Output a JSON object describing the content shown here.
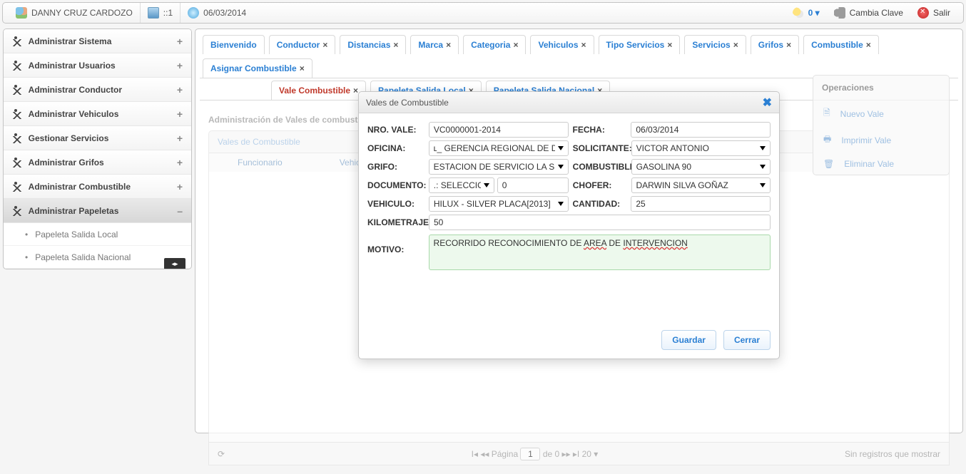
{
  "topbar": {
    "user": "DANNY CRUZ CARDOZO",
    "host": "::1",
    "date": "06/03/2014",
    "weather": "0 ▾",
    "changepw": "Cambia Clave",
    "exit": "Salir"
  },
  "sidebar": {
    "items": [
      {
        "label": "Administrar Sistema"
      },
      {
        "label": "Administrar Usuarios"
      },
      {
        "label": "Administrar Conductor"
      },
      {
        "label": "Administrar Vehiculos"
      },
      {
        "label": "Gestionar Servicios"
      },
      {
        "label": "Administrar Grifos"
      },
      {
        "label": "Administrar Combustible"
      },
      {
        "label": "Administrar Papeletas"
      }
    ],
    "subitems": [
      {
        "label": "Papeleta Salida Local"
      },
      {
        "label": "Papeleta Salida Nacional"
      }
    ]
  },
  "tabs": {
    "row1": [
      {
        "label": "Bienvenido",
        "closable": false
      },
      {
        "label": "Conductor",
        "closable": true
      },
      {
        "label": "Distancias",
        "closable": true
      },
      {
        "label": "Marca",
        "closable": true
      },
      {
        "label": "Categoria",
        "closable": true
      },
      {
        "label": "Vehiculos",
        "closable": true
      },
      {
        "label": "Tipo Servicios",
        "closable": true
      },
      {
        "label": "Servicios",
        "closable": true
      },
      {
        "label": "Grifos",
        "closable": true
      },
      {
        "label": "Combustible",
        "closable": true
      },
      {
        "label": "Asignar Combustible",
        "closable": true
      }
    ],
    "row2": [
      {
        "label": "Vale Combustible",
        "closable": true,
        "active": true
      },
      {
        "label": "Papeleta Salida Local",
        "closable": true
      },
      {
        "label": "Papeleta Salida Nacional",
        "closable": true
      }
    ]
  },
  "content": {
    "section_title": "Administración de Vales de combustible",
    "grid_title": "Vales de Combustible",
    "grid_cols": [
      "Funcionario",
      "Vehiculo"
    ],
    "pager": "Página",
    "pager_page": "1",
    "pager_of": "de 0",
    "pager_size": "20 ▾",
    "empty": "Sin registros que mostrar"
  },
  "ops": {
    "title": "Operaciones",
    "items": [
      "Nuevo Vale",
      "Imprimir Vale",
      "Eliminar Vale"
    ]
  },
  "modal": {
    "title": "Vales de Combustible",
    "labels": {
      "nro": "NRO. VALE:",
      "fecha": "FECHA:",
      "oficina": "OFICINA:",
      "solicitante": "SOLICITANTE:",
      "grifo": "GRIFO:",
      "combustible": "COMBUSTIBLE:",
      "documento": "DOCUMENTO:",
      "chofer": "CHOFER:",
      "vehiculo": "VEHICULO:",
      "cantidad": "CANTIDAD:",
      "kilometraje": "KILOMETRAJE:",
      "motivo": "MOTIVO:"
    },
    "values": {
      "nro": "VC0000001-2014",
      "fecha": "06/03/2014",
      "oficina": "ʟ_ GERENCIA REGIONAL DE DE",
      "solicitante": "VICTOR ANTONIO",
      "grifo": "ESTACION DE SERVICIO LA SELVA",
      "combustible": "GASOLINA 90",
      "documento": ".: SELECCIONE",
      "docnum": "0",
      "chofer": "DARWIN SILVA GOÑAZ",
      "vehiculo": "HILUX - SILVER PLACA[2013]",
      "cantidad": "25",
      "kilometraje": "50",
      "motivo_a": "RECORRIDO RECONOCIMIENTO DE ",
      "motivo_b": "AREA",
      "motivo_c": " DE ",
      "motivo_d": "INTERVENCION"
    },
    "buttons": {
      "save": "Guardar",
      "close": "Cerrar"
    }
  }
}
